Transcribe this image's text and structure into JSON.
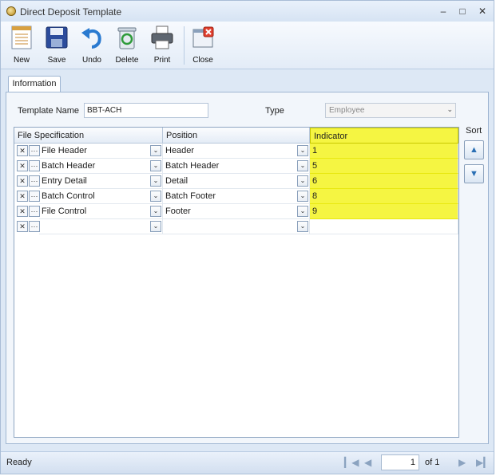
{
  "window": {
    "title": "Direct Deposit Template",
    "minimize": "–",
    "maximize": "□",
    "close": "✕"
  },
  "toolbar": {
    "new_label": "New",
    "save_label": "Save",
    "undo_label": "Undo",
    "delete_label": "Delete",
    "print_label": "Print",
    "close_label": "Close"
  },
  "tabs": {
    "information": "Information"
  },
  "form": {
    "template_name_label": "Template Name",
    "template_name_value": "BBT-ACH",
    "type_label": "Type",
    "type_value": "Employee"
  },
  "grid": {
    "headers": [
      "File Specification",
      "Position",
      "Indicator"
    ],
    "rows": [
      {
        "spec": "File Header",
        "position": "Header",
        "indicator": "1"
      },
      {
        "spec": "Batch Header",
        "position": "Batch Header",
        "indicator": "5"
      },
      {
        "spec": "Entry Detail",
        "position": "Detail",
        "indicator": "6"
      },
      {
        "spec": "Batch Control",
        "position": "Batch Footer",
        "indicator": "8"
      },
      {
        "spec": "File Control",
        "position": "Footer",
        "indicator": "9"
      },
      {
        "spec": "",
        "position": "",
        "indicator": ""
      }
    ],
    "highlight_color": "#f5f542"
  },
  "sort": {
    "label": "Sort",
    "up": "▲",
    "down": "▼"
  },
  "status": {
    "text": "Ready",
    "page": "1",
    "of_label": "of 1"
  }
}
